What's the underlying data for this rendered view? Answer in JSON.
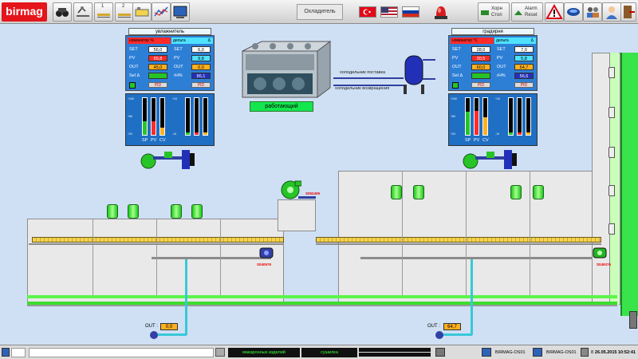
{
  "toolbar": {
    "logo": "birmag",
    "logo_sub": "",
    "icons": [
      "binoculars-icon",
      "conveyor-view-icon",
      "line-1-icon",
      "line-2-icon",
      "overview-icon",
      "trend-icon",
      "screen-list-icon"
    ],
    "line1_num": "1",
    "line2_num": "2",
    "screen_title": "Охладитель",
    "flags": [
      "turkish-flag",
      "us-flag",
      "russian-flag"
    ],
    "start_stop": "Хорн\nСтоп",
    "start_stop_l1": "Хорн",
    "start_stop_l2": "Стоп",
    "alarm_reset_l1": "Alarm",
    "alarm_reset_l2": "Reset"
  },
  "left_panel": {
    "title": "увлажнитель",
    "tab_left": "номинатор %",
    "tab_right": "дельта",
    "tab_right_symbol": "Δ",
    "set_label": "SET",
    "set_value": "56,0",
    "set2_value": "6,0",
    "pv_label": "PV",
    "pv_value": "65,8",
    "pv2_value": "9,8",
    "out_label": "OUT",
    "out_value": "45,0",
    "out2_value": "0,0",
    "sel_label": "Sel Δ",
    "sel_value": "",
    "rh_label": "rH%",
    "rh_value": "86,1",
    "pid1": "PID",
    "pid2": "PID",
    "bar_labels": [
      "SP",
      "PV",
      "CV"
    ],
    "bar_fill": [
      0.37,
      0.36,
      0.2
    ],
    "bar2_fill": [
      0.06,
      0.06,
      0.06
    ]
  },
  "right_panel": {
    "title": "градирня",
    "tab_left": "номинатор °С",
    "tab_right": "дельта",
    "tab_right_symbol": "Δ",
    "set_label": "SET",
    "set_value": "28,0",
    "set2_value": "7,0",
    "pv_label": "PV",
    "pv_value": "30,5",
    "pv2_value": "5,8",
    "out_label": "OUT",
    "out_value": "60,0",
    "out2_value": "64,7",
    "sel_label": "Sel Δ",
    "sel_value": "",
    "rh_label": "rH%",
    "rh_value": "56,6",
    "pid1": "PID",
    "pid2": "PID",
    "bar_labels": [
      "SP",
      "PV",
      "CV"
    ],
    "bar_fill": [
      0.62,
      0.65,
      0.48
    ],
    "bar2_fill": [
      0.06,
      0.06,
      0.06
    ]
  },
  "chiller": {
    "status": "работающий",
    "supply_label": "холодильник поставка",
    "return_label": "холодильник возвращения"
  },
  "plant": {
    "fan_tag": "S052409",
    "pump_left_tag": "S040576",
    "pump_right_tag": "S049376",
    "out_left_label": "OUT :",
    "out_left_value": "0,0",
    "out_right_label": "OUT :",
    "out_right_value": "64,7"
  },
  "statusbar": {
    "field1": "",
    "field2": "макаронных изделий",
    "field3": "сушилка автоматическая",
    "field4a": "",
    "field4b": "",
    "field5": "BIRMAG-OS01",
    "field6": "BIRMAG-OS01",
    "field7": "8",
    "datetime": "26.05.2015 10:52:41"
  },
  "colors": {
    "brand": "#e4161b",
    "running": "#13e64e",
    "alarm_red": "#ff2a2a",
    "panel_blue": "#2d7fd6"
  }
}
